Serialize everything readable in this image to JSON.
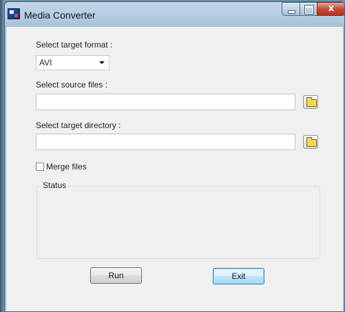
{
  "window": {
    "title": "Media Converter",
    "controls": {
      "minimize": "minimize",
      "maximize": "maximize",
      "close": "x"
    }
  },
  "format": {
    "label": "Select target format :",
    "selected": "AVI"
  },
  "source": {
    "label": "Select source files :",
    "value": "",
    "browse_icon": "folder-icon"
  },
  "target": {
    "label": "Select target directory :",
    "value": "",
    "browse_icon": "folder-icon"
  },
  "merge": {
    "label": "Merge files",
    "checked": false
  },
  "status": {
    "label": "Status"
  },
  "buttons": {
    "run": "Run",
    "exit": "Exit"
  },
  "colors": {
    "title_bar": "#aec6dc",
    "close_button": "#c74a35",
    "client_background": "#f0f0f0",
    "default_button": "#a7d9f5"
  }
}
